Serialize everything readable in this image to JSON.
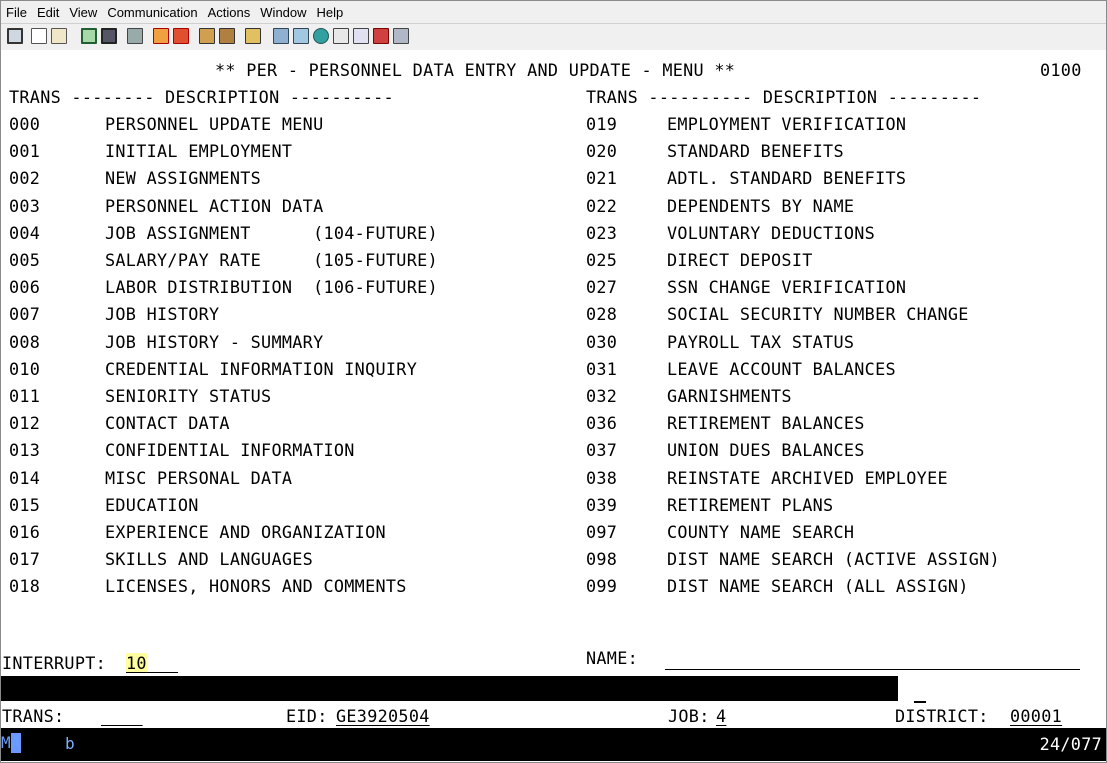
{
  "menu": [
    "File",
    "Edit",
    "View",
    "Communication",
    "Actions",
    "Window",
    "Help"
  ],
  "toolbar_icons": [
    "screen-icon",
    "copy-icon",
    "paste-icon",
    "send-icon",
    "receive-icon",
    "macro-icon",
    "record-icon",
    "play-icon",
    "stop-icon",
    "transfer-up-icon",
    "transfer-down-icon",
    "clipboard-icon",
    "network-icon",
    "hierarchy-icon",
    "globe-icon",
    "tools-icon",
    "keys-icon",
    "edit-icon",
    "help-icon"
  ],
  "title": "** PER - PERSONNEL DATA ENTRY AND UPDATE - MENU **",
  "screen_id": "0100",
  "left_header": "TRANS -------- DESCRIPTION ----------",
  "right_header": "TRANS ---------- DESCRIPTION ---------",
  "left_items": [
    {
      "code": "000",
      "desc": "PERSONNEL UPDATE MENU"
    },
    {
      "code": "001",
      "desc": "INITIAL EMPLOYMENT"
    },
    {
      "code": "002",
      "desc": "NEW ASSIGNMENTS"
    },
    {
      "code": "003",
      "desc": "PERSONNEL ACTION DATA"
    },
    {
      "code": "004",
      "desc": "JOB ASSIGNMENT      (104-FUTURE)"
    },
    {
      "code": "005",
      "desc": "SALARY/PAY RATE     (105-FUTURE)"
    },
    {
      "code": "006",
      "desc": "LABOR DISTRIBUTION  (106-FUTURE)"
    },
    {
      "code": "007",
      "desc": "JOB HISTORY"
    },
    {
      "code": "008",
      "desc": "JOB HISTORY - SUMMARY"
    },
    {
      "code": "010",
      "desc": "CREDENTIAL INFORMATION INQUIRY"
    },
    {
      "code": "011",
      "desc": "SENIORITY STATUS"
    },
    {
      "code": "012",
      "desc": "CONTACT DATA"
    },
    {
      "code": "013",
      "desc": "CONFIDENTIAL INFORMATION"
    },
    {
      "code": "014",
      "desc": "MISC PERSONAL DATA"
    },
    {
      "code": "015",
      "desc": "EDUCATION"
    },
    {
      "code": "016",
      "desc": "EXPERIENCE AND ORGANIZATION"
    },
    {
      "code": "017",
      "desc": "SKILLS AND LANGUAGES"
    },
    {
      "code": "018",
      "desc": "LICENSES, HONORS AND COMMENTS"
    }
  ],
  "right_items": [
    {
      "code": "019",
      "desc": "EMPLOYMENT VERIFICATION"
    },
    {
      "code": "020",
      "desc": "STANDARD BENEFITS"
    },
    {
      "code": "021",
      "desc": "ADTL. STANDARD BENEFITS"
    },
    {
      "code": "022",
      "desc": "DEPENDENTS BY NAME"
    },
    {
      "code": "023",
      "desc": "VOLUNTARY DEDUCTIONS"
    },
    {
      "code": "025",
      "desc": "DIRECT DEPOSIT"
    },
    {
      "code": "027",
      "desc": "SSN CHANGE VERIFICATION"
    },
    {
      "code": "028",
      "desc": "SOCIAL SECURITY NUMBER CHANGE"
    },
    {
      "code": "030",
      "desc": "PAYROLL TAX STATUS"
    },
    {
      "code": "031",
      "desc": "LEAVE ACCOUNT BALANCES"
    },
    {
      "code": "032",
      "desc": "GARNISHMENTS"
    },
    {
      "code": "036",
      "desc": "RETIREMENT BALANCES"
    },
    {
      "code": "037",
      "desc": "UNION DUES BALANCES"
    },
    {
      "code": "038",
      "desc": "REINSTATE ARCHIVED EMPLOYEE"
    },
    {
      "code": "039",
      "desc": "RETIREMENT PLANS"
    },
    {
      "code": "097",
      "desc": "COUNTY NAME SEARCH"
    },
    {
      "code": "098",
      "desc": "DIST NAME SEARCH (ACTIVE ASSIGN)"
    },
    {
      "code": "099",
      "desc": "DIST NAME SEARCH (ALL ASSIGN)"
    }
  ],
  "name_label": "NAME:",
  "name_value": "",
  "interrupt_label": "INTERRUPT:",
  "interrupt_value": "10",
  "trans_label": "TRANS:",
  "trans_value": "",
  "eid_label": "EID:",
  "eid_value": "GE3920504",
  "job_label": "JOB:",
  "job_value": "4",
  "district_label": "DISTRICT:",
  "district_value": "00001",
  "status": {
    "mode": "MA",
    "indicator": "b",
    "cursor_pos": "24/077"
  },
  "colors": {
    "highlight": "#ffff9f",
    "status_bar": "#000000",
    "status_mode": "#6aa0ff"
  }
}
